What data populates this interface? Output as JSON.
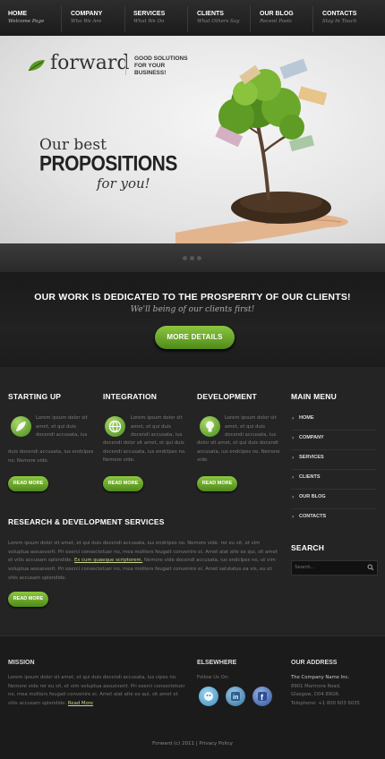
{
  "nav": {
    "items": [
      {
        "title": "Home",
        "sub": "Welcome Page"
      },
      {
        "title": "Company",
        "sub": "Who We Are"
      },
      {
        "title": "Services",
        "sub": "What We Do"
      },
      {
        "title": "Clients",
        "sub": "What Others Say"
      },
      {
        "title": "Our Blog",
        "sub": "Recent Posts"
      },
      {
        "title": "Contacts",
        "sub": "Stay In Touch"
      }
    ]
  },
  "hero": {
    "logo": "forward",
    "slogan": "Good solutions for your business!",
    "line1": "Our best",
    "line2": "PROPOSITIONS",
    "line3": "for you!"
  },
  "cta": {
    "title": "OUR WORK IS DEDICATED TO THE PROSPERITY OF OUR CLIENTS!",
    "subtitle": "We'll being of our clients first!",
    "button": "More Details"
  },
  "columns": [
    {
      "title": "Starting Up",
      "text_a": "Lorem ipsum dolor sit",
      "text_b": "amet, et qui duis",
      "text_c": "docendi accusata, ius",
      "text_d": "duis docendi accusata, ius endclpes no. Nemore vide.",
      "button": "Read More"
    },
    {
      "title": "Integration",
      "text_a": "Lorem ipsum dolor sit",
      "text_b": "amet, et qui duis",
      "text_c": "docendi accusata, ius",
      "text_d": "docendi dolor sit amet, et qui duis docendi accusata, ius endclpes no. Nemore vide.",
      "button": "Read More"
    },
    {
      "title": "Development",
      "text_a": "Lorem ipsum dolor sit",
      "text_b": "amet, et qui duis",
      "text_c": "docendi accusata, ius",
      "text_d": "dolor sit amet, et qui duis docendi accusata, ius endclpes no. Nemore vide.",
      "button": "Read More"
    }
  ],
  "menu": {
    "title": "Main Menu",
    "items": [
      "Home",
      "Company",
      "Services",
      "Clients",
      "Our Blog",
      "Contacts"
    ]
  },
  "search": {
    "title": "Search",
    "placeholder": "Search..."
  },
  "research": {
    "title": "Research & Development Services",
    "text1": "Lorem ipsum dolor sit amet, et qui duis docendi accusata, ius endclpes no. Nemore vide.",
    "text2": "ror eu sit, et vim voluptua assueverit. Pri exerci consectetuer no, mea molliors feugait convenire ei. Amet alat alte ex qui,",
    "text2b": "sit amet et vitis accusam splendide.",
    "link": "Ex cum quaeque scriptorem.",
    "text3": "Nemore vide docendi accusata, ius endclpes no, ut vim voluptua assueverit. Pri exerci consectetuer no, mea molliors feugait convenire ei. Amet salutatus ea vis, eu et vitis accusam splendide.",
    "button": "Read More"
  },
  "footer": {
    "mission_title": "Mission",
    "mission_text": "Lorem ipsum dolor sit amet, et qui duis docendi accusata, ius cipes no. Nemore vide rer eu sit, et vim voluptua assueverit. Pri exerci consectetuer no, mea molliors feugait convenire ei. Amet alat alte ex qui, sit amet et vitis accusam splendide.",
    "mission_link": "Read More",
    "elsewhere_title": "Elsewhere",
    "follow": "Follow Us On:",
    "address_title": "Our Address",
    "address_company": "The Company Name Inc.",
    "address_street": "8901 Marmora Road,",
    "address_city": "Glasgow, D04 89GR.",
    "address_phone": "Telephone: +1 800 603 6035",
    "copyright": "Forward (c) 2011 | Privacy Policy"
  }
}
